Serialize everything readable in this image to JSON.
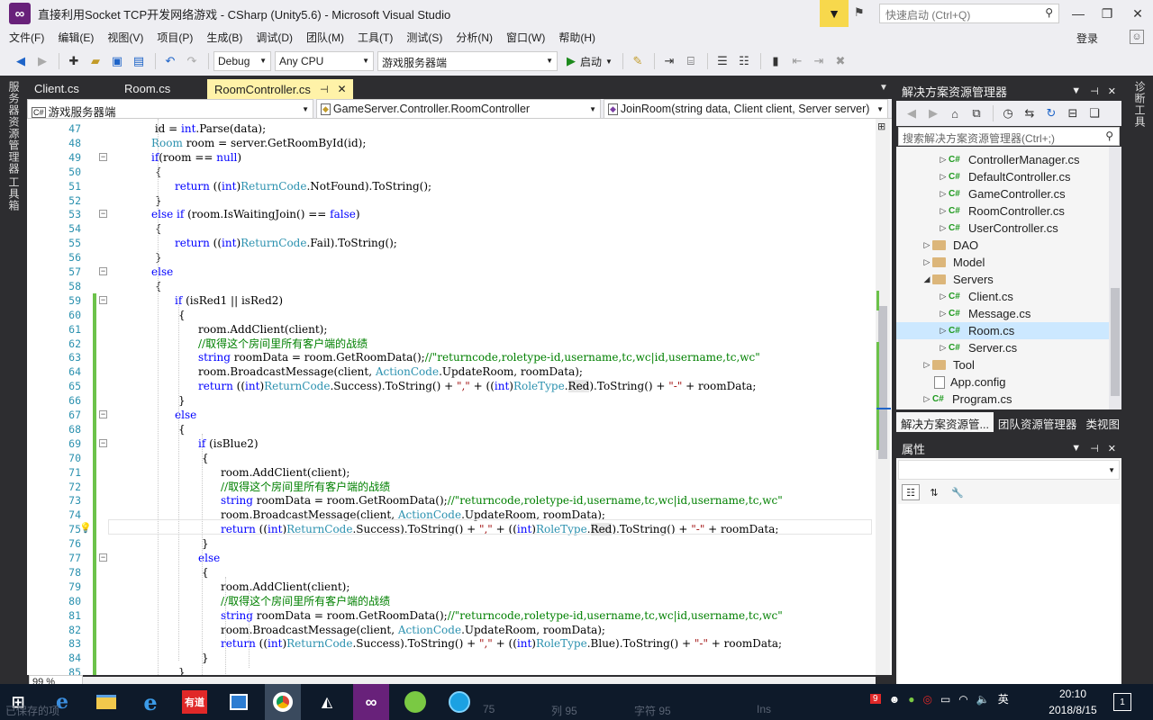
{
  "window": {
    "title": "直接利用Socket TCP开发网络游戏 - CSharp (Unity5.6) - Microsoft Visual Studio",
    "quick_launch_placeholder": "快速启动 (Ctrl+Q)"
  },
  "menu": [
    "文件(F)",
    "编辑(E)",
    "视图(V)",
    "项目(P)",
    "生成(B)",
    "调试(D)",
    "团队(M)",
    "工具(T)",
    "测试(S)",
    "分析(N)",
    "窗口(W)",
    "帮助(H)"
  ],
  "login_label": "登录",
  "toolbar": {
    "config": "Debug",
    "platform": "Any CPU",
    "startup_project": "游戏服务器端",
    "run_label": "启动"
  },
  "left_strip": [
    "服务器资源管理器",
    "工具箱"
  ],
  "right_strip": [
    "诊断工具"
  ],
  "doc_tabs": [
    "Client.cs",
    "Room.cs",
    "RoomController.cs"
  ],
  "navbar": {
    "project": "游戏服务器端",
    "type": "GameServer.Controller.RoomController",
    "member": "JoinRoom(string data, Client client, Server server)"
  },
  "editor": {
    "zoom": "99 %",
    "lines": [
      {
        "n": "47",
        "t": [
          [
            "",
            "int",
            "kw"
          ],
          [
            " id = ",
            ""
          ],
          [
            "int",
            "kw"
          ],
          [
            ".Parse(data);",
            ""
          ]
        ]
      },
      {
        "n": "48",
        "t": [
          [
            "Room",
            "ty"
          ],
          [
            " room = server.GetRoomById(id);",
            ""
          ]
        ]
      },
      {
        "n": "49",
        "t": [
          [
            "if",
            "kw"
          ],
          [
            "(room == ",
            ""
          ],
          [
            "null",
            "kw"
          ],
          [
            ")",
            ""
          ]
        ]
      },
      {
        "n": "50",
        "t": [
          [
            "{",
            ""
          ]
        ]
      },
      {
        "n": "51",
        "t": [
          [
            "return",
            "kw"
          ],
          [
            " ((",
            ""
          ],
          [
            "int",
            "kw"
          ],
          [
            ")",
            ""
          ],
          [
            "ReturnCode",
            "ty"
          ],
          [
            ".NotFound).ToString();",
            ""
          ]
        ]
      },
      {
        "n": "52",
        "t": [
          [
            "}",
            ""
          ]
        ]
      },
      {
        "n": "53",
        "t": [
          [
            "else if",
            "kw"
          ],
          [
            " (room.IsWaitingJoin() == ",
            ""
          ],
          [
            "false",
            "kw"
          ],
          [
            ")",
            ""
          ]
        ]
      },
      {
        "n": "54",
        "t": [
          [
            "{",
            ""
          ]
        ]
      },
      {
        "n": "55",
        "t": [
          [
            "return",
            "kw"
          ],
          [
            " ((",
            ""
          ],
          [
            "int",
            "kw"
          ],
          [
            ")",
            ""
          ],
          [
            "ReturnCode",
            "ty"
          ],
          [
            ".Fail).ToString();",
            ""
          ]
        ]
      },
      {
        "n": "56",
        "t": [
          [
            "}",
            ""
          ]
        ]
      },
      {
        "n": "57",
        "t": [
          [
            "else",
            "kw"
          ]
        ]
      },
      {
        "n": "58",
        "t": [
          [
            "{",
            ""
          ]
        ]
      },
      {
        "n": "59",
        "t": [
          [
            "if",
            "kw"
          ],
          [
            " (isRed1 || isRed2)",
            ""
          ]
        ]
      },
      {
        "n": "60",
        "t": [
          [
            "{",
            ""
          ]
        ]
      },
      {
        "n": "61",
        "t": [
          [
            "room.AddClient(client);",
            ""
          ]
        ]
      },
      {
        "n": "62",
        "t": [
          [
            "//取得这个房间里所有客户端的战绩",
            "cm"
          ]
        ]
      },
      {
        "n": "63",
        "t": [
          [
            "string",
            "kw"
          ],
          [
            " roomData = room.GetRoomData();",
            ""
          ],
          [
            "//\"returncode,roletype-id,username,tc,wc|id,username,tc,wc\"",
            "cm"
          ]
        ]
      },
      {
        "n": "64",
        "t": [
          [
            "room.BroadcastMessage(client, ",
            ""
          ],
          [
            "ActionCode",
            "ty"
          ],
          [
            ".UpdateRoom, roomData);",
            ""
          ]
        ]
      },
      {
        "n": "65",
        "t": [
          [
            "return",
            "kw"
          ],
          [
            " ((",
            ""
          ],
          [
            "int",
            "kw"
          ],
          [
            ")",
            ""
          ],
          [
            "ReturnCode",
            "ty"
          ],
          [
            ".Success).ToString() + ",
            ""
          ],
          [
            "\",\"",
            "st"
          ],
          [
            " + ((",
            ""
          ],
          [
            "int",
            "kw"
          ],
          [
            ")",
            ""
          ],
          [
            "RoleType",
            "ty"
          ],
          [
            ".",
            ""
          ],
          [
            "Red",
            "hl"
          ],
          [
            ").ToString() + ",
            ""
          ],
          [
            "\"-\"",
            "st"
          ],
          [
            " + roomData;",
            ""
          ]
        ]
      },
      {
        "n": "66",
        "t": [
          [
            "}",
            ""
          ]
        ]
      },
      {
        "n": "67",
        "t": [
          [
            "else",
            "kw"
          ]
        ]
      },
      {
        "n": "68",
        "t": [
          [
            "{",
            ""
          ]
        ]
      },
      {
        "n": "69",
        "t": [
          [
            "if",
            "kw"
          ],
          [
            " (isBlue2)",
            ""
          ]
        ]
      },
      {
        "n": "70",
        "t": [
          [
            "{",
            ""
          ]
        ]
      },
      {
        "n": "71",
        "t": [
          [
            "room.AddClient(client);",
            ""
          ]
        ]
      },
      {
        "n": "72",
        "t": [
          [
            "//取得这个房间里所有客户端的战绩",
            "cm"
          ]
        ]
      },
      {
        "n": "73",
        "t": [
          [
            "string",
            "kw"
          ],
          [
            " roomData = room.GetRoomData();",
            ""
          ],
          [
            "//\"returncode,roletype-id,username,tc,wc|id,username,tc,wc\"",
            "cm"
          ]
        ]
      },
      {
        "n": "74",
        "t": [
          [
            "room.BroadcastMessage(client, ",
            ""
          ],
          [
            "ActionCode",
            "ty"
          ],
          [
            ".UpdateRoom, roomData);",
            ""
          ]
        ]
      },
      {
        "n": "75",
        "t": [
          [
            "return",
            "kw"
          ],
          [
            " ((",
            ""
          ],
          [
            "int",
            "kw"
          ],
          [
            ")",
            ""
          ],
          [
            "ReturnCode",
            "ty"
          ],
          [
            ".Success).ToString() + ",
            ""
          ],
          [
            "\",\"",
            "st"
          ],
          [
            " + ((",
            ""
          ],
          [
            "int",
            "kw"
          ],
          [
            ")",
            ""
          ],
          [
            "RoleType",
            "ty"
          ],
          [
            ".",
            ""
          ],
          [
            "Red",
            "hl"
          ],
          [
            ").ToString() + ",
            ""
          ],
          [
            "\"-\"",
            "st"
          ],
          [
            " + roomData;",
            ""
          ]
        ]
      },
      {
        "n": "76",
        "t": [
          [
            "}",
            ""
          ]
        ]
      },
      {
        "n": "77",
        "t": [
          [
            "else",
            "kw"
          ]
        ]
      },
      {
        "n": "78",
        "t": [
          [
            "{",
            ""
          ]
        ]
      },
      {
        "n": "79",
        "t": [
          [
            "room.AddClient(client);",
            ""
          ]
        ]
      },
      {
        "n": "80",
        "t": [
          [
            "//取得这个房间里所有客户端的战绩",
            "cm"
          ]
        ]
      },
      {
        "n": "81",
        "t": [
          [
            "string",
            "kw"
          ],
          [
            " roomData = room.GetRoomData();",
            ""
          ],
          [
            "//\"returncode,roletype-id,username,tc,wc|id,username,tc,wc\"",
            "cm"
          ]
        ]
      },
      {
        "n": "82",
        "t": [
          [
            "room.BroadcastMessage(client, ",
            ""
          ],
          [
            "ActionCode",
            "ty"
          ],
          [
            ".UpdateRoom, roomData);",
            ""
          ]
        ]
      },
      {
        "n": "83",
        "t": [
          [
            "return",
            "kw"
          ],
          [
            " ((",
            ""
          ],
          [
            "int",
            "kw"
          ],
          [
            ")",
            ""
          ],
          [
            "ReturnCode",
            "ty"
          ],
          [
            ".Success).ToString() + ",
            ""
          ],
          [
            "\",\"",
            "st"
          ],
          [
            " + ((",
            ""
          ],
          [
            "int",
            "kw"
          ],
          [
            ")",
            ""
          ],
          [
            "RoleType",
            "ty"
          ],
          [
            ".Blue).ToString() + ",
            ""
          ],
          [
            "\"-\"",
            "st"
          ],
          [
            " + roomData;",
            ""
          ]
        ]
      },
      {
        "n": "84",
        "t": [
          [
            "}",
            ""
          ]
        ]
      },
      {
        "n": "85",
        "t": [
          [
            "}",
            ""
          ]
        ]
      }
    ]
  },
  "solution_explorer": {
    "title": "解决方案资源管理器",
    "search_placeholder": "搜索解决方案资源管理器(Ctrl+;)",
    "items": [
      {
        "label": "ControllerManager.cs",
        "kind": "cs"
      },
      {
        "label": "DefaultController.cs",
        "kind": "cs"
      },
      {
        "label": "GameController.cs",
        "kind": "cs"
      },
      {
        "label": "RoomController.cs",
        "kind": "cs"
      },
      {
        "label": "UserController.cs",
        "kind": "cs"
      },
      {
        "label": "DAO",
        "kind": "folder"
      },
      {
        "label": "Model",
        "kind": "folder"
      },
      {
        "label": "Servers",
        "kind": "folder"
      },
      {
        "label": "Client.cs",
        "kind": "cs"
      },
      {
        "label": "Message.cs",
        "kind": "cs"
      },
      {
        "label": "Room.cs",
        "kind": "cs",
        "selected": true
      },
      {
        "label": "Server.cs",
        "kind": "cs"
      },
      {
        "label": "Tool",
        "kind": "folder"
      },
      {
        "label": "App.config",
        "kind": "config"
      },
      {
        "label": "Program.cs",
        "kind": "cs"
      }
    ],
    "tabs": [
      "解决方案资源管...",
      "团队资源管理器",
      "类视图"
    ]
  },
  "properties": {
    "title": "属性"
  },
  "statusbar_ghost": {
    "save": "已保存的项",
    "ln": "75",
    "col": "列 95",
    "ch": "字符 95",
    "ins": "Ins"
  },
  "taskbar": {
    "time": "20:10",
    "date": "2018/8/15",
    "ime": "英",
    "notification_count": "1",
    "youdao_label": "有道"
  },
  "colors": {
    "accent": "#68217a",
    "tab_active": "#fff2a8",
    "chrome": "#2d2d30",
    "change_bar": "#6cc24a"
  }
}
